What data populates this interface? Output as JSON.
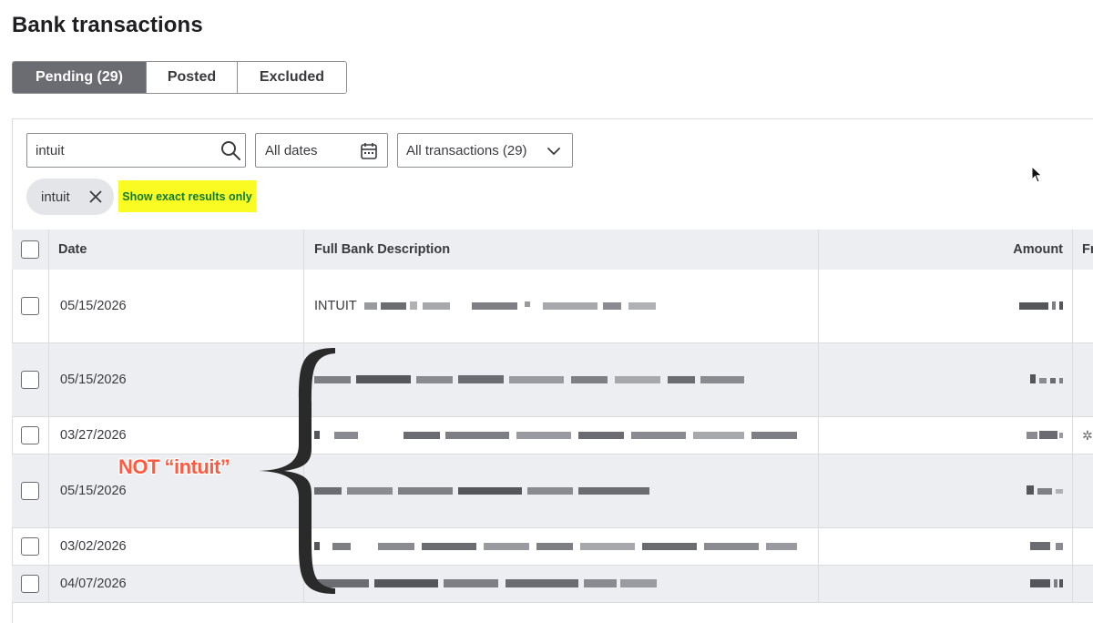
{
  "page": {
    "title": "Bank transactions"
  },
  "tabs": [
    {
      "label": "Pending (29)",
      "active": true
    },
    {
      "label": "Posted",
      "active": false
    },
    {
      "label": "Excluded",
      "active": false
    }
  ],
  "filters": {
    "search_value": "intuit",
    "dates_label": "All dates",
    "transactions_label": "All transactions (29)"
  },
  "chip": {
    "label": "intuit"
  },
  "exact_results_button": {
    "label": "Show exact results only"
  },
  "table": {
    "headers": {
      "date": "Date",
      "description": "Full Bank Description",
      "amount": "Amount",
      "from": "Fr"
    },
    "rows": [
      {
        "date": "05/15/2026",
        "description_prefix": "INTUIT",
        "shaded": false
      },
      {
        "date": "05/15/2026",
        "description_prefix": "",
        "shaded": true
      },
      {
        "date": "03/27/2026",
        "description_prefix": "",
        "shaded": false
      },
      {
        "date": "05/15/2026",
        "description_prefix": "",
        "shaded": true
      },
      {
        "date": "03/02/2026",
        "description_prefix": "",
        "shaded": false
      },
      {
        "date": "04/07/2026",
        "description_prefix": "",
        "shaded": true
      }
    ]
  },
  "annotation": {
    "text": "NOT “intuit”",
    "color": "#ff5a40"
  },
  "colors": {
    "active_tab": "#6b6c72",
    "highlight": "#fbfb24",
    "highlight_text": "#107a2c",
    "row_shade": "#eceef1"
  }
}
